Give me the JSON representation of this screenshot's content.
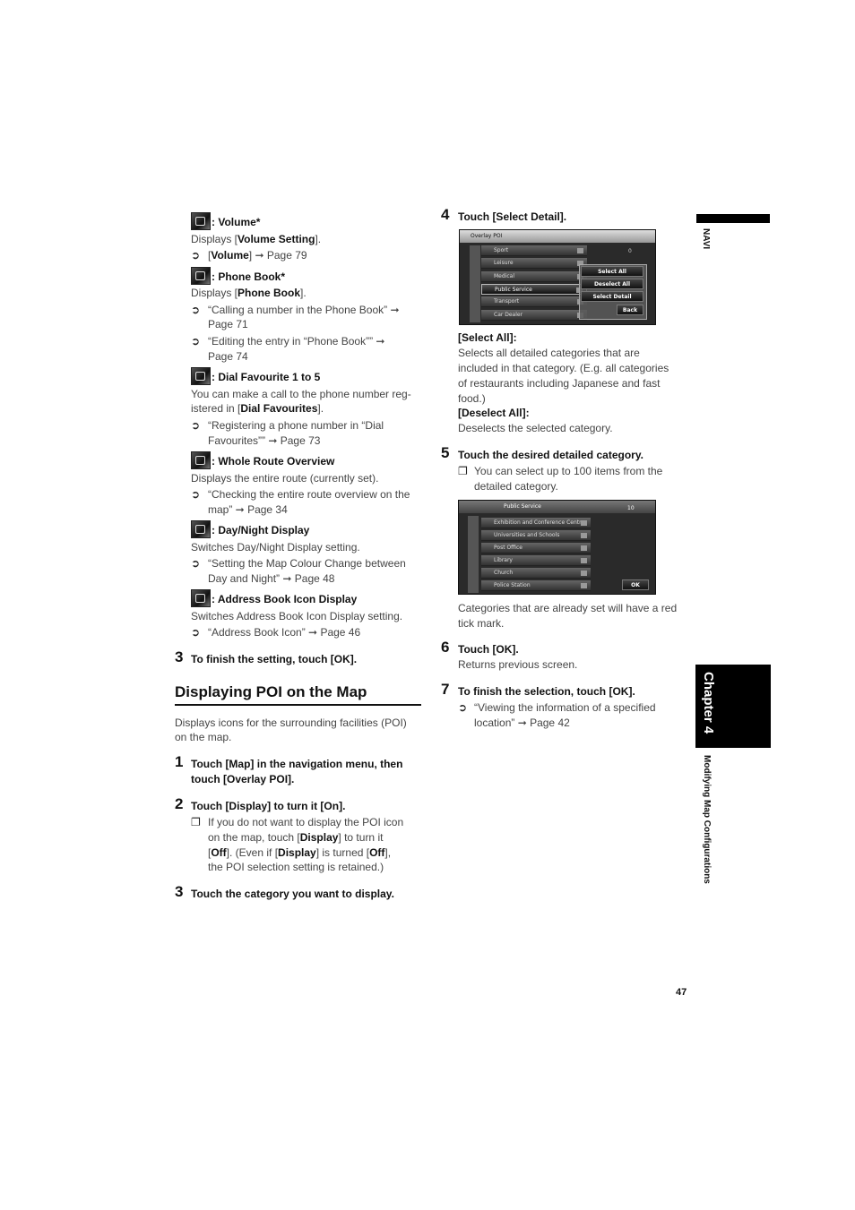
{
  "lines": [
    {
      "segs": [
        {
          "t": ": Volume*"
        }
      ],
      "icon": "volume-icon"
    },
    {
      "segs": [
        {
          "t": "Displays ["
        },
        {
          "t": "Volume Setting",
          "b": true
        },
        {
          "t": "]."
        }
      ]
    },
    {
      "segs": [
        {
          "t": "["
        },
        {
          "t": "Volume",
          "b": true
        },
        {
          "t": "] ➞ Page 79"
        }
      ]
    },
    {
      "segs": [
        {
          "t": ": Phone Book*"
        }
      ],
      "icon": "phone-book-icon"
    },
    {
      "segs": [
        {
          "t": "Displays ["
        },
        {
          "t": "Phone Book",
          "b": true
        },
        {
          "t": "]."
        }
      ]
    },
    {
      "segs": [
        {
          "t": "“Calling a number in the Phone Book” ➞"
        }
      ]
    },
    {
      "segs": [
        {
          "t": "Page 71"
        }
      ]
    },
    {
      "segs": [
        {
          "t": "“Editing the entry in “Phone Book”” ➞"
        }
      ]
    },
    {
      "segs": [
        {
          "t": "Page 74"
        }
      ]
    },
    {
      "segs": [
        {
          "t": ": Dial Favourite 1 to 5"
        }
      ],
      "icon": "dial-favourite-icon"
    },
    {
      "segs": [
        {
          "t": "You can make a call to the phone number reg-"
        }
      ]
    },
    {
      "segs": [
        {
          "t": "istered in ["
        },
        {
          "t": "Dial Favourites",
          "b": true
        },
        {
          "t": "]."
        }
      ]
    },
    {
      "segs": [
        {
          "t": "“Registering a phone number in “Dial"
        }
      ]
    },
    {
      "segs": [
        {
          "t": "Favourites”” ➞ Page 73"
        }
      ]
    },
    {
      "segs": [
        {
          "t": ": Whole Route Overview"
        }
      ],
      "icon": "route-overview-icon"
    },
    {
      "segs": [
        {
          "t": "Displays the entire route (currently set)."
        }
      ]
    },
    {
      "segs": [
        {
          "t": "“Checking the entire route overview on the"
        }
      ]
    },
    {
      "segs": [
        {
          "t": "map” ➞ Page 34"
        }
      ]
    },
    {
      "segs": [
        {
          "t": ": Day/Night Display"
        }
      ],
      "icon": "day-night-icon"
    },
    {
      "segs": [
        {
          "t": "Switches Day/Night Display setting."
        }
      ]
    },
    {
      "segs": [
        {
          "t": "“Setting the Map Colour Change between"
        }
      ]
    },
    {
      "segs": [
        {
          "t": "Day and Night” ➞ Page 48"
        }
      ]
    },
    {
      "segs": [
        {
          "t": ": Address Book Icon Display"
        }
      ],
      "icon": "address-book-icon"
    },
    {
      "segs": [
        {
          "t": "Switches Address Book Icon Display setting."
        }
      ]
    },
    {
      "segs": [
        {
          "t": "“Address Book Icon” ➞ Page 46"
        }
      ]
    },
    {
      "num": "3",
      "segs": [
        {
          "t": "To finish the setting, touch [OK]."
        }
      ]
    },
    {
      "segs": [
        {
          "t": "Displays icons for the surrounding facilities (POI)"
        }
      ]
    },
    {
      "segs": [
        {
          "t": "on the map."
        }
      ]
    },
    {
      "num": "1",
      "segs": [
        {
          "t": "Touch [Map] in the navigation menu, then"
        }
      ]
    },
    {
      "segs": [
        {
          "t": "touch [Overlay POI]."
        }
      ]
    },
    {
      "num": "2",
      "segs": [
        {
          "t": "Touch [Display] to turn it [On]."
        }
      ]
    },
    {
      "segs": [
        {
          "t": "If you do not want to display the POI icon"
        }
      ]
    },
    {
      "segs": [
        {
          "t": "on the map, touch ["
        },
        {
          "t": "Display",
          "b": true
        },
        {
          "t": "] to turn it"
        }
      ]
    },
    {
      "segs": [
        {
          "t": "["
        },
        {
          "t": "Off",
          "b": true
        },
        {
          "t": "]. (Even if ["
        },
        {
          "t": "Display",
          "b": true
        },
        {
          "t": "] is turned ["
        },
        {
          "t": "Off",
          "b": true
        },
        {
          "t": "],"
        }
      ]
    },
    {
      "segs": [
        {
          "t": "the POI selection setting is retained.)"
        }
      ]
    },
    {
      "num": "3",
      "segs": [
        {
          "t": "Touch the category you want to display."
        }
      ]
    },
    {
      "num": "4",
      "segs": [
        {
          "t": "Touch [Select Detail]."
        }
      ]
    },
    {
      "segs": [
        {
          "t": "[Select All]:"
        }
      ]
    },
    {
      "segs": [
        {
          "t": "Selects all detailed categories that are"
        }
      ]
    },
    {
      "segs": [
        {
          "t": "included in that category. (E.g. all categories"
        }
      ]
    },
    {
      "segs": [
        {
          "t": "of restaurants including Japanese and fast"
        }
      ]
    },
    {
      "segs": [
        {
          "t": "food.)"
        }
      ]
    },
    {
      "segs": [
        {
          "t": "[Deselect All]:"
        }
      ]
    },
    {
      "segs": [
        {
          "t": "Deselects the selected category."
        }
      ]
    },
    {
      "num": "5",
      "segs": [
        {
          "t": "Touch the desired detailed category."
        }
      ]
    },
    {
      "segs": [
        {
          "t": "You can select up to 100 items from the"
        }
      ]
    },
    {
      "segs": [
        {
          "t": "detailed category."
        }
      ]
    },
    {
      "segs": [
        {
          "t": "Categories that are already set will have a red"
        }
      ]
    },
    {
      "segs": [
        {
          "t": "tick mark."
        }
      ]
    },
    {
      "num": "6",
      "segs": [
        {
          "t": "Touch [OK]."
        }
      ]
    },
    {
      "segs": [
        {
          "t": "Returns previous screen."
        }
      ]
    },
    {
      "num": "7",
      "segs": [
        {
          "t": "To finish the selection, touch [OK]."
        }
      ]
    },
    {
      "segs": [
        {
          "t": "“Viewing the information of a specified"
        }
      ]
    },
    {
      "segs": [
        {
          "t": "location” ➞ Page 42"
        }
      ]
    }
  ],
  "markers": {
    "ref": "➲",
    "note": "❐"
  },
  "section_title": "Displaying POI on the Map",
  "screen1": {
    "title": "Overlay POI",
    "count": "0",
    "items": [
      "Sport",
      "Leisure",
      "Medical",
      "Public Service",
      "Transport",
      "Car Dealer"
    ],
    "selected": "Public Service",
    "buttons": [
      "Select All",
      "Deselect All",
      "Select Detail",
      "Back"
    ]
  },
  "screen2": {
    "title": "Public Service",
    "count": "10",
    "items": [
      "Exhibition and Conference Centre",
      "Universities and Schools",
      "Post Office",
      "Library",
      "Church",
      "Police Station"
    ],
    "ok": "OK"
  },
  "side": {
    "tab": "NAVI",
    "chapter": "Chapter 4",
    "chapter_title": "Modifying Map Configurations"
  },
  "page_number": "47"
}
